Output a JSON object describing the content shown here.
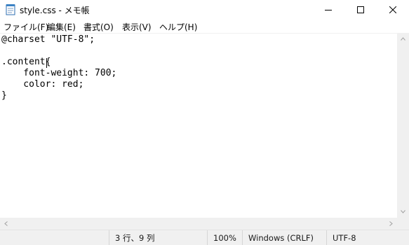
{
  "window": {
    "title": "style.css - メモ帳",
    "icon": "notepad-icon"
  },
  "controls": {
    "minimize": "minimize-icon",
    "maximize": "maximize-icon",
    "close": "close-icon"
  },
  "menu": {
    "file": "ファイル(F)",
    "edit": "編集(E)",
    "format": "書式(O)",
    "view": "表示(V)",
    "help": "ヘルプ(H)"
  },
  "editor": {
    "content": "@charset \"UTF-8\";\n\n.content{\n    font-weight: 700;\n    color: red;\n}"
  },
  "status": {
    "position": "3 行、9 列",
    "zoom": "100%",
    "line_ending": "Windows (CRLF)",
    "encoding": "UTF-8"
  }
}
